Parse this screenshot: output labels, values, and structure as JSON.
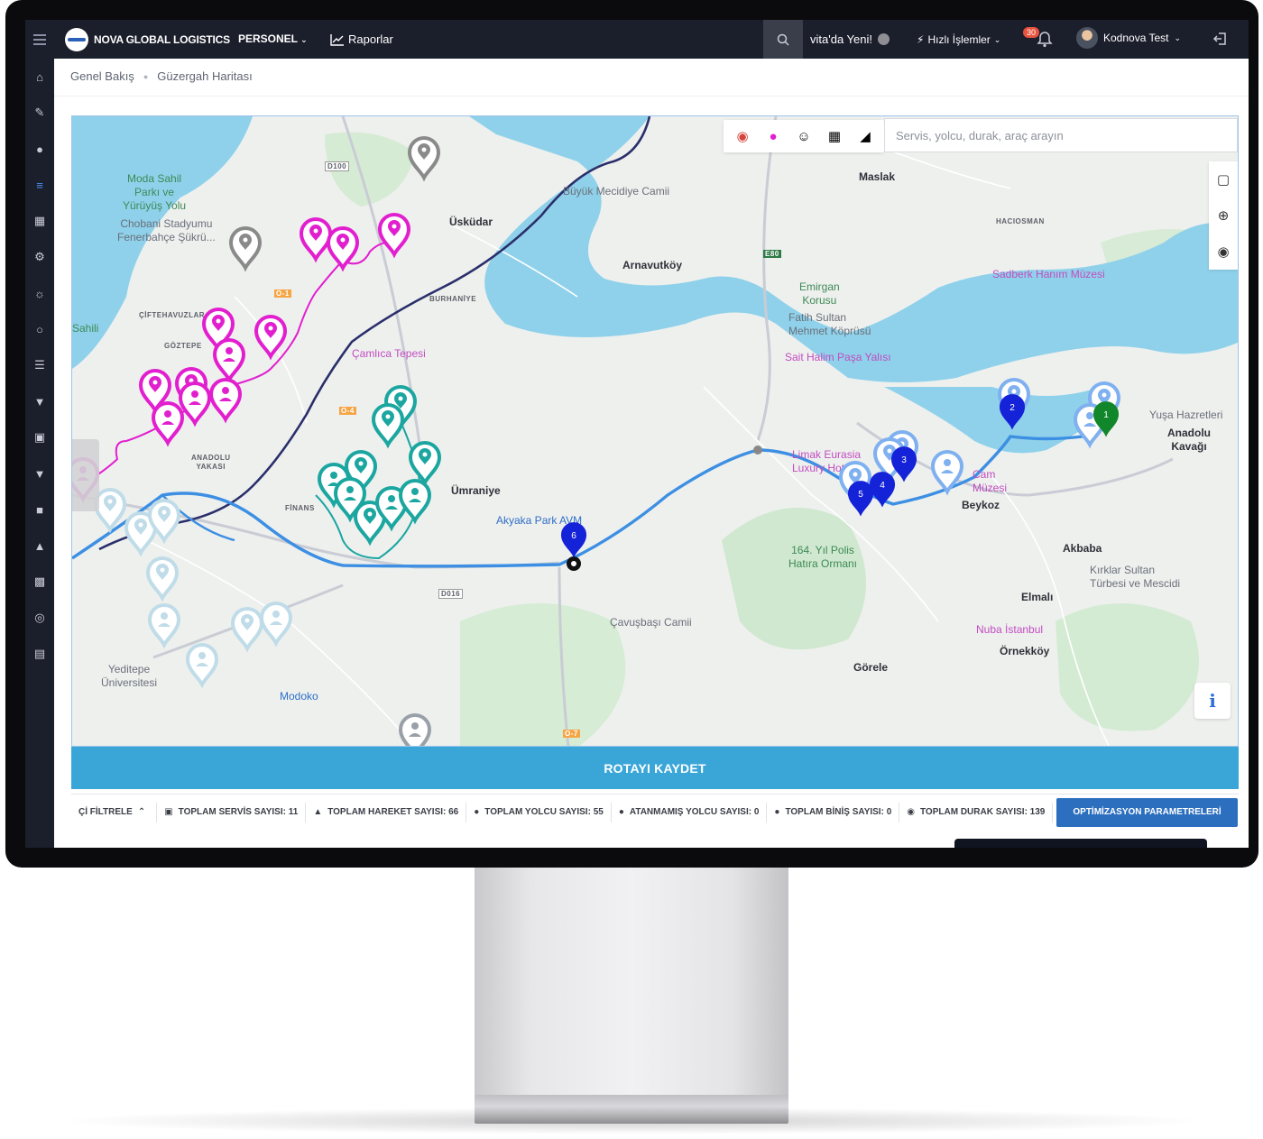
{
  "app": {
    "brand": "NOVA GLOBAL LOGISTICS",
    "nav": {
      "personel": "PERSONEL",
      "raporlar": "Raporlar"
    },
    "vita": "vita'da Yeni!",
    "quick": "Hızlı İşlemler",
    "notification_count": "30",
    "user": "Kodnova Test"
  },
  "breadcrumb": [
    "Genel Bakış",
    "Güzergah Haritası"
  ],
  "map": {
    "search_placeholder": "Servis, yolcu, durak, araç arayın",
    "labels": {
      "moda": "Moda Sahil\nParkı ve\nYürüyüş Yolu",
      "chobani": "Chobani Stadyumu\nFenerbahçe Şükrü...",
      "uskudar": "Üsküdar",
      "buyuk": "Büyük Mecidiye Camii",
      "arnavutkoy": "Arnavutköy",
      "maslak": "Maslak",
      "haciosman": "HACIOSMAN",
      "sadberk": "Sadberk Hanım Müzesi",
      "emirgan": "Emirgan\nKorusu",
      "fatih": "Fatih Sultan\nMehmet Köprüsü",
      "sait": "Sait Halim Paşa Yalısı",
      "camlica": "Çamlıca Tepesi",
      "ciftehavuzlar": "ÇİFTEHAVUZLAR",
      "goztepe": "GÖZTEPE",
      "burhaniye": "BURHANİYE",
      "sahili": "Sahili",
      "anadolu": "ANADOLU\nYAKASI",
      "umraniye": "Ümraniye",
      "akyaka": "Akyaka Park AVM",
      "limak": "Limak Eurasia\nLuxury Hotel",
      "yusa": "Yuşa Hazretleri",
      "anadolu_kavagi": "Anadolu\nKavağı",
      "beykoz": "Beykoz",
      "cam_muzesi": "Cam\nMüzesi",
      "polis": "164. Yıl Polis\nHatıra Ormanı",
      "akbaba": "Akbaba",
      "kirklar": "Kırklar Sultan\nTürbesi ve Mescidi",
      "elmali": "Elmalı",
      "nuba": "Nuba İstanbul",
      "ornekkoy": "Örnekköy",
      "cavusbasi": "Çavuşbaşı Camii",
      "gorele": "Görele",
      "yeditepe": "Yeditepe\nÜniversitesi",
      "modoko": "Modoko",
      "finans": "FİNANS",
      "d100": "D100",
      "e80": "E80",
      "d016": "D016",
      "o1": "O-1",
      "o4": "O-4",
      "o7": "O-7"
    },
    "stop_numbers": [
      "1",
      "2",
      "3",
      "4",
      "5",
      "6"
    ],
    "colors": {
      "magenta": "#e21fcf",
      "teal": "#1ba6a0",
      "blue": "#1422d8",
      "route": "#3d8fe3",
      "navy": "#2a2f6b",
      "pale": "#bfdce8"
    }
  },
  "save_button": "ROTAYI KAYDET",
  "stats": {
    "filter": "Çİ FİLTRELE",
    "items": [
      "TOPLAM SERVİS SAYISI: 11",
      "TOPLAM HAREKET SAYISI: 66",
      "TOPLAM YOLCU SAYISI: 55",
      "ATANMAMIŞ YOLCU SAYISI: 0",
      "TOPLAM BİNİŞ SAYISI: 0",
      "TOPLAM DURAK SAYISI: 139"
    ],
    "optimize_button": "OPTİMİZASYON PARAMETRELERİ"
  }
}
